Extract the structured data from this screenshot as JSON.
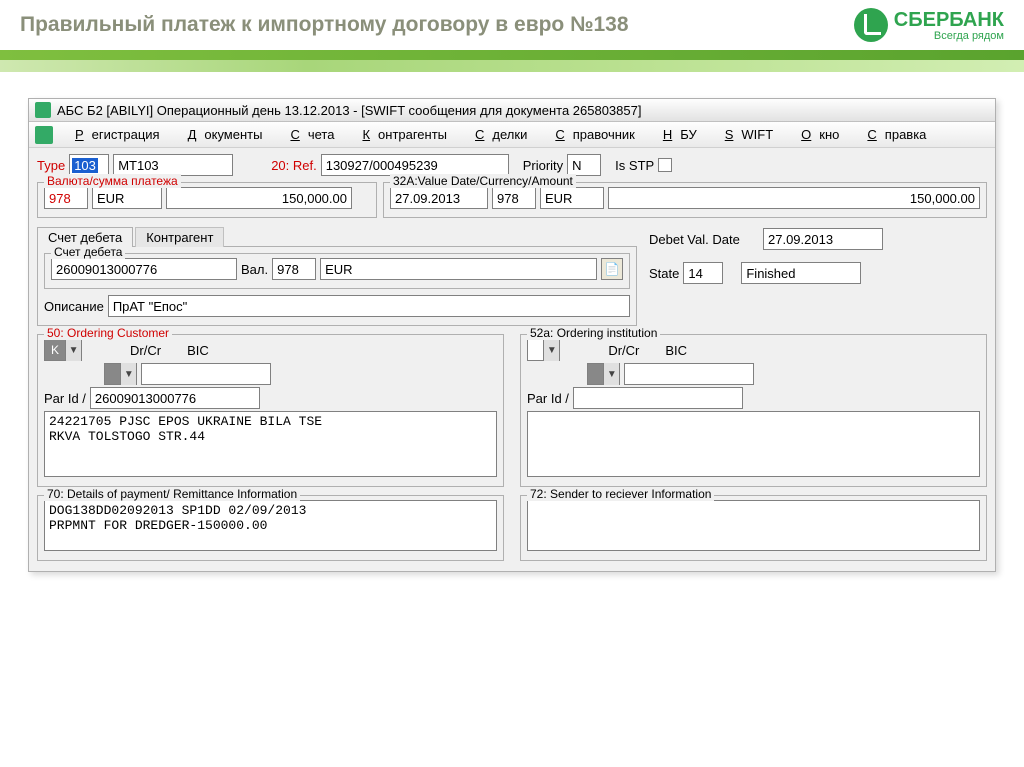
{
  "slide": {
    "title": "Правильный платеж к импортному договору в евро №138",
    "brand": "СБЕРБАНК",
    "tagline": "Всегда рядом"
  },
  "window": {
    "title": "АБС Б2 [ABILYI] Операционный день 13.12.2013 - [SWIFT сообщения для документа 265803857]"
  },
  "menu": [
    "Регистрация",
    "Документы",
    "Счета",
    "Контрагенты",
    "Сделки",
    "Справочник",
    "НБУ",
    "SWIFT",
    "Окно",
    "Справка"
  ],
  "form": {
    "type_label": "Type",
    "type_code": "103",
    "mt": "MT103",
    "ref_label": "20: Ref.",
    "ref": "130927/000495239",
    "priority_label": "Priority",
    "priority": "N",
    "isstp_label": "Is STP",
    "currency_group": "Валюта/сумма платежа",
    "cur_code": "978",
    "cur": "EUR",
    "amount": "150,000.00",
    "vda_group": "32A:Value Date/Currency/Amount",
    "vda_date": "27.09.2013",
    "vda_code": "978",
    "vda_cur": "EUR",
    "vda_amount": "150,000.00",
    "tabs": [
      "Счет дебета",
      "Контрагент"
    ],
    "debit_group": "Счет дебета",
    "debit_acct": "26009013000776",
    "val_label": "Вал.",
    "val_code": "978",
    "val_cur": "EUR",
    "desc_label": "Описание",
    "desc_value": "ПрАТ \"Епос\"",
    "debet_date_label": "Debet Val. Date",
    "debet_date": "27.09.2013",
    "state_label": "State",
    "state": "14",
    "state_text": "Finished",
    "f50": {
      "legend": "50: Ordering Customer",
      "drcr": "Dr/Cr",
      "bic": "BIC",
      "parid": "Par Id /",
      "parid_val": "26009013000776",
      "body": "24221705 PJSC EPOS UKRAINE BILA TSE\nRKVA TOLSTOGO STR.44",
      "k": "K"
    },
    "f52": {
      "legend": "52a: Ordering institution",
      "drcr": "Dr/Cr",
      "bic": "BIC",
      "parid": "Par Id /",
      "body": ""
    },
    "f70": {
      "legend": "70: Details of payment/ Remittance Information",
      "body": "DOG138DD02092013 SP1DD 02/09/2013\nPRPMNT FOR DREDGER-150000.00"
    },
    "f72": {
      "legend": "72: Sender to reciever Information",
      "body": ""
    }
  }
}
